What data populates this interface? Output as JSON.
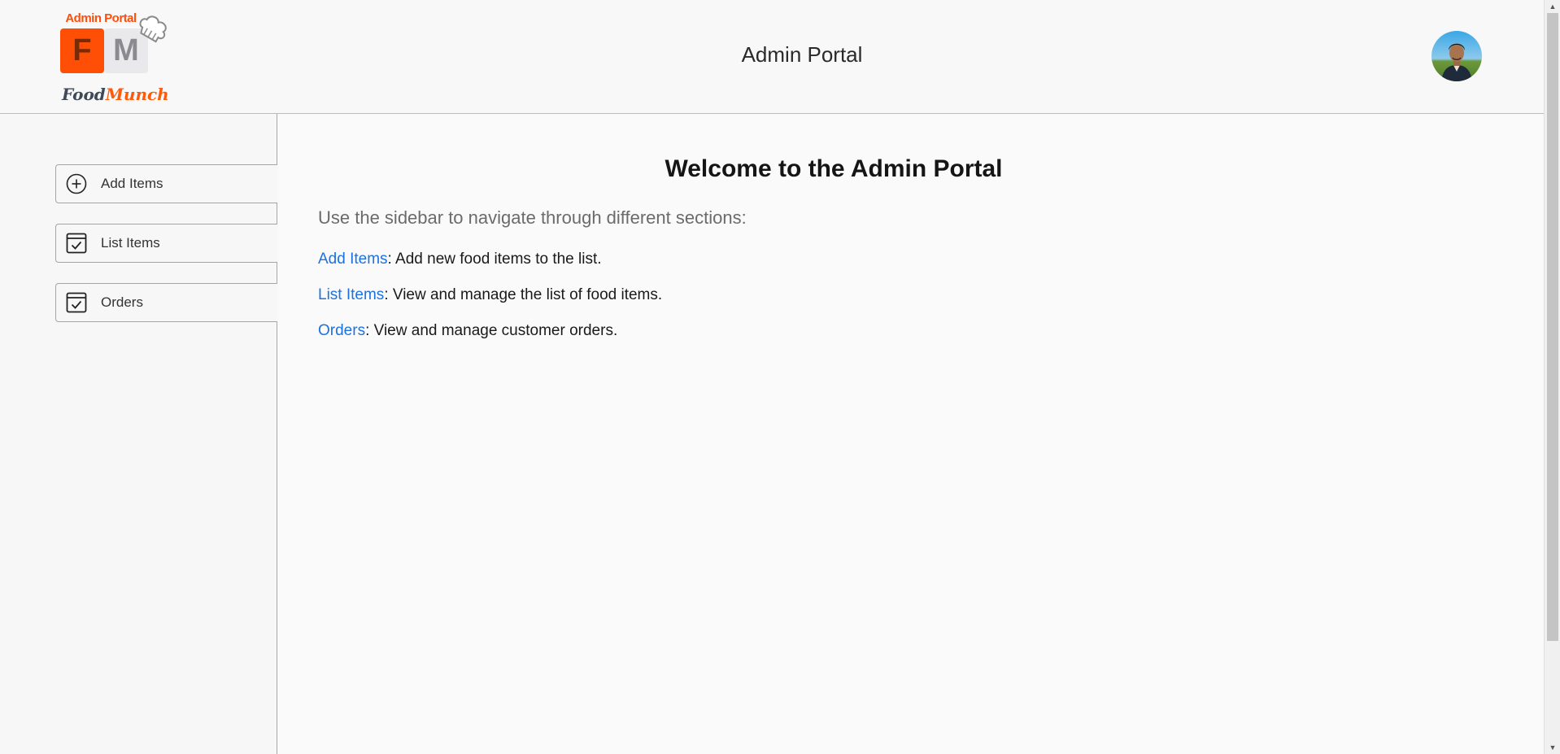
{
  "header": {
    "logo_caption": "Admin Portal",
    "logo_letters": [
      "F",
      "M"
    ],
    "brand_part1": "Food",
    "brand_part2": "Munch",
    "title": "Admin Portal"
  },
  "sidebar": {
    "items": [
      {
        "label": "Add Items",
        "icon": "add-circle-icon"
      },
      {
        "label": "List Items",
        "icon": "checkbox-calendar-icon"
      },
      {
        "label": "Orders",
        "icon": "checkbox-calendar-icon"
      }
    ]
  },
  "main": {
    "heading": "Welcome to the Admin Portal",
    "subtitle": "Use the sidebar to navigate through different sections:",
    "lines": [
      {
        "link": "Add Items",
        "text": ": Add new food items to the list."
      },
      {
        "link": "List Items",
        "text": ": View and manage the list of food items."
      },
      {
        "link": "Orders",
        "text": ": View and manage customer orders."
      }
    ]
  },
  "colors": {
    "accent_orange": "#ff4e05",
    "link_blue": "#1c72e0",
    "background": "#f7f7f7"
  }
}
